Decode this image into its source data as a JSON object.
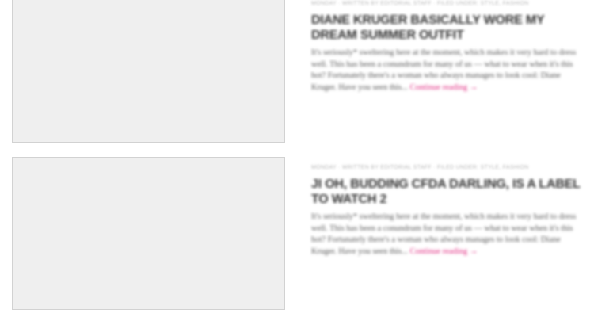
{
  "posts": [
    {
      "meta": "MONDAY · WRITTEN BY EDITORIAL STAFF · FILED UNDER: STYLE, FASHION",
      "title": "DIANE KRUGER BASICALLY WORE MY DREAM SUMMER OUTFIT",
      "excerpt": "It's seriously* sweltering here at the moment, which makes it very hard to dress well. This has been a conundrum for many of us — what to wear when it's this hot? Fortunately there's a woman who always manages to look cool: Diane Kruger. Have you seen this...",
      "more": "Continue reading →"
    },
    {
      "meta": "MONDAY · WRITTEN BY EDITORIAL STAFF · FILED UNDER: STYLE, FASHION",
      "title": "JI OH, BUDDING CFDA DARLING, IS A LABEL TO WATCH 2",
      "excerpt": "It's seriously* sweltering here at the moment, which makes it very hard to dress well. This has been a conundrum for many of us — what to wear when it's this hot? Fortunately there's a woman who always manages to look cool: Diane Kruger. Have you seen this...",
      "more": "Continue reading →"
    }
  ]
}
